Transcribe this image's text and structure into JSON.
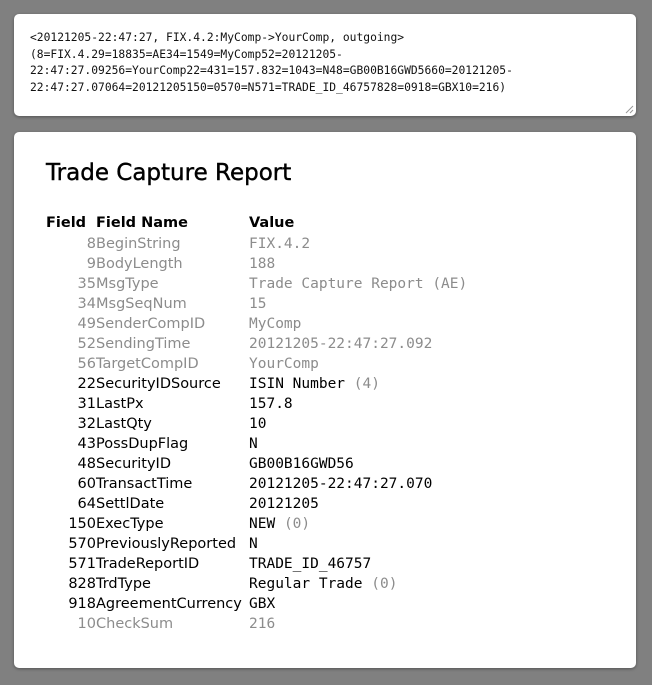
{
  "raw_message": {
    "lines": [
      "<20121205-22:47:27, FIX.4.2:MyComp->YourComp, outgoing>",
      "(8=FIX.4.29=18835=AE34=1549=MyComp52=20121205-",
      "22:47:27.09256=YourComp22=431=157.832=1043=N48=GB00B16GWD5660=20121205-",
      "22:47:27.07064=20121205150=0570=N571=TRADE_ID_46757828=0918=GBX10=216)"
    ]
  },
  "report": {
    "title": "Trade Capture Report",
    "columns": {
      "field": "Field",
      "name": "Field Name",
      "value": "Value"
    },
    "rows": [
      {
        "tag": "8",
        "name": "BeginString",
        "value": "FIX.4.2",
        "code": "",
        "kind": "header"
      },
      {
        "tag": "9",
        "name": "BodyLength",
        "value": "188",
        "code": "",
        "kind": "header"
      },
      {
        "tag": "35",
        "name": "MsgType",
        "value": "Trade Capture Report (AE)",
        "code": "",
        "kind": "header"
      },
      {
        "tag": "34",
        "name": "MsgSeqNum",
        "value": "15",
        "code": "",
        "kind": "header"
      },
      {
        "tag": "49",
        "name": "SenderCompID",
        "value": "MyComp",
        "code": "",
        "kind": "header"
      },
      {
        "tag": "52",
        "name": "SendingTime",
        "value": "20121205-22:47:27.092",
        "code": "",
        "kind": "header"
      },
      {
        "tag": "56",
        "name": "TargetCompID",
        "value": "YourComp",
        "code": "",
        "kind": "header"
      },
      {
        "tag": "22",
        "name": "SecurityIDSource",
        "value": "ISIN Number",
        "code": "(4)",
        "kind": "body"
      },
      {
        "tag": "31",
        "name": "LastPx",
        "value": "157.8",
        "code": "",
        "kind": "body"
      },
      {
        "tag": "32",
        "name": "LastQty",
        "value": "10",
        "code": "",
        "kind": "body"
      },
      {
        "tag": "43",
        "name": "PossDupFlag",
        "value": "N",
        "code": "",
        "kind": "body"
      },
      {
        "tag": "48",
        "name": "SecurityID",
        "value": "GB00B16GWD56",
        "code": "",
        "kind": "body"
      },
      {
        "tag": "60",
        "name": "TransactTime",
        "value": "20121205-22:47:27.070",
        "code": "",
        "kind": "body"
      },
      {
        "tag": "64",
        "name": "SettlDate",
        "value": "20121205",
        "code": "",
        "kind": "body"
      },
      {
        "tag": "150",
        "name": "ExecType",
        "value": "NEW",
        "code": "(0)",
        "kind": "body"
      },
      {
        "tag": "570",
        "name": "PreviouslyReported",
        "value": "N",
        "code": "",
        "kind": "body"
      },
      {
        "tag": "571",
        "name": "TradeReportID",
        "value": "TRADE_ID_46757",
        "code": "",
        "kind": "body"
      },
      {
        "tag": "828",
        "name": "TrdType",
        "value": "Regular Trade",
        "code": "(0)",
        "kind": "body"
      },
      {
        "tag": "918",
        "name": "AgreementCurrency",
        "value": "GBX",
        "code": "",
        "kind": "body"
      },
      {
        "tag": "10",
        "name": "CheckSum",
        "value": "216",
        "code": "",
        "kind": "header"
      }
    ]
  },
  "colors": {
    "background": "#808080",
    "panel": "#ffffff",
    "muted_text": "#8c8c8c",
    "text": "#000000"
  }
}
